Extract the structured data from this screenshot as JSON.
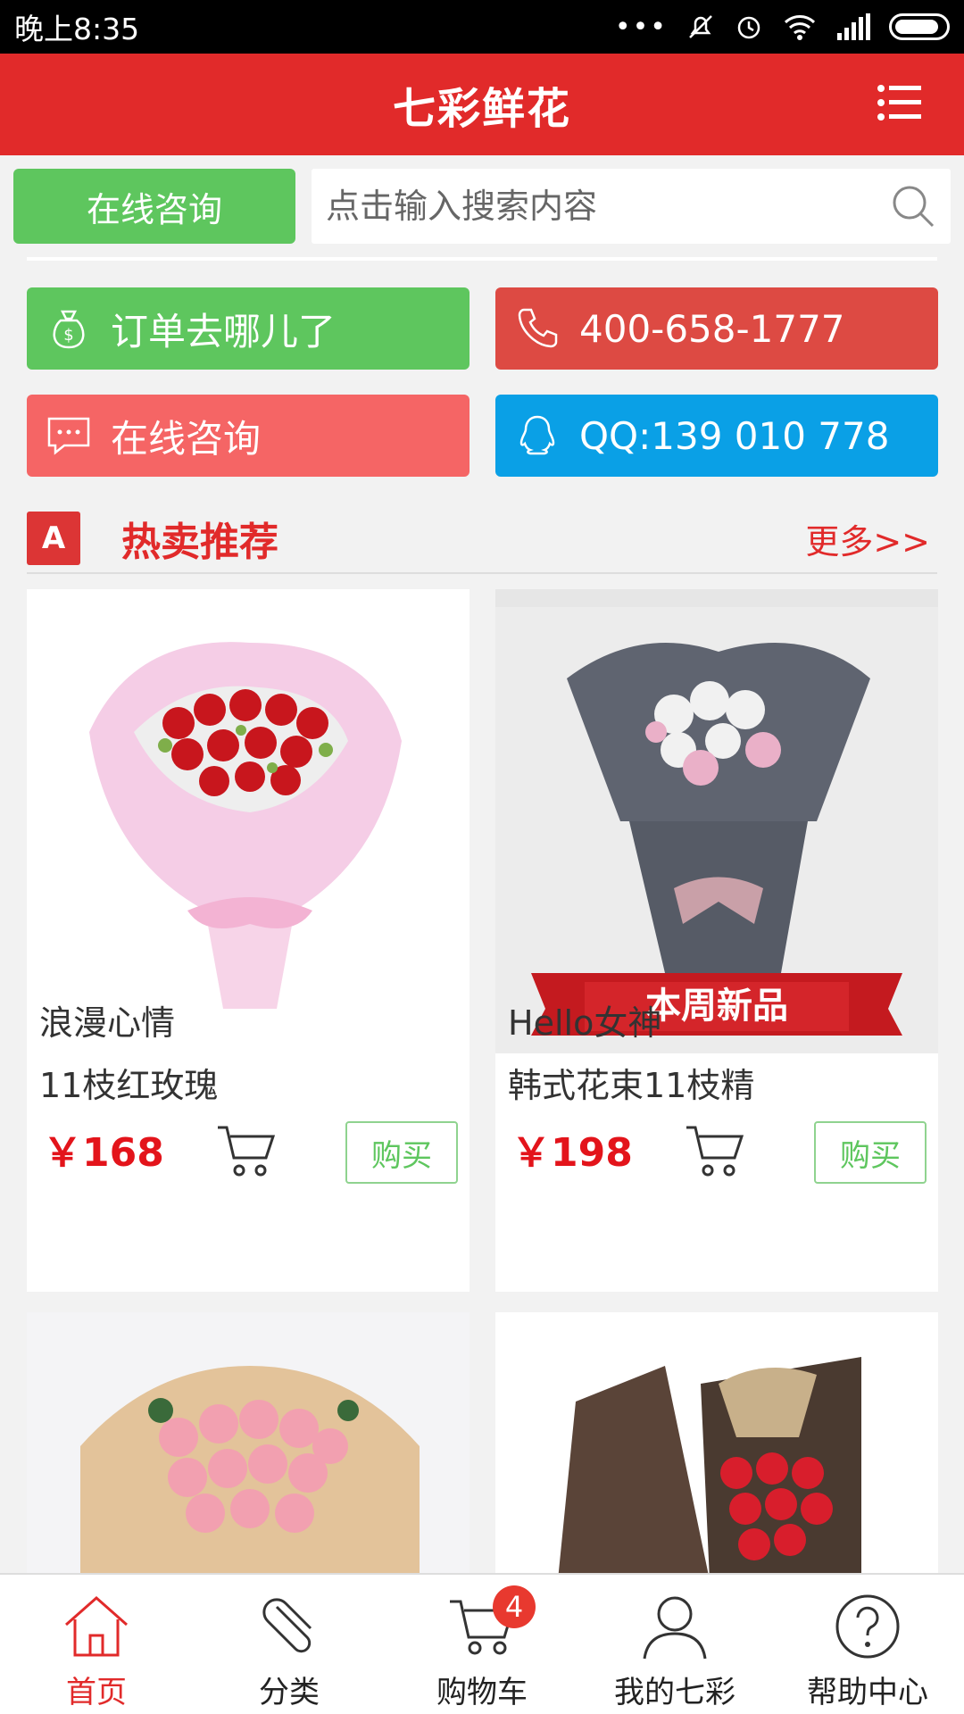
{
  "status_bar": {
    "time": "晚上8:35",
    "dots": "•••"
  },
  "header": {
    "title": "七彩鲜花"
  },
  "search": {
    "consult_label": "在线咨询",
    "placeholder": "点击输入搜索内容",
    "value": ""
  },
  "quick_links": [
    {
      "label": "订单去哪儿了",
      "icon": "money-bag-icon",
      "color": "#5ec65e"
    },
    {
      "label": "400-658-1777",
      "icon": "phone-icon",
      "color": "#dd4a43"
    },
    {
      "label": "在线咨询",
      "icon": "chat-icon",
      "color": "#f56565"
    },
    {
      "label": "QQ:139 010 778",
      "icon": "qq-icon",
      "color": "#0aa0e6"
    }
  ],
  "section": {
    "badge": "A",
    "title": "热卖推荐",
    "more": "更多>>"
  },
  "products": [
    {
      "name": "浪漫心情",
      "desc": "11枝红玫瑰",
      "price": "￥168",
      "buy_label": "购买"
    },
    {
      "name": "Hello女神",
      "desc": "韩式花束11枝精",
      "price": "￥198",
      "buy_label": "购买",
      "ribbon": "本周新品"
    },
    {
      "name": "",
      "desc": "",
      "price": ""
    },
    {
      "name": "",
      "desc": "",
      "price": ""
    }
  ],
  "bottom_nav": [
    {
      "label": "首页",
      "icon": "home-icon",
      "active": true
    },
    {
      "label": "分类",
      "icon": "paperclip-icon"
    },
    {
      "label": "购物车",
      "icon": "cart-icon",
      "badge": "4"
    },
    {
      "label": "我的七彩",
      "icon": "user-icon"
    },
    {
      "label": "帮助中心",
      "icon": "help-icon"
    }
  ],
  "colors": {
    "brand_red": "#e12a2a",
    "green": "#5ec65e",
    "price_red": "#e3141b"
  }
}
